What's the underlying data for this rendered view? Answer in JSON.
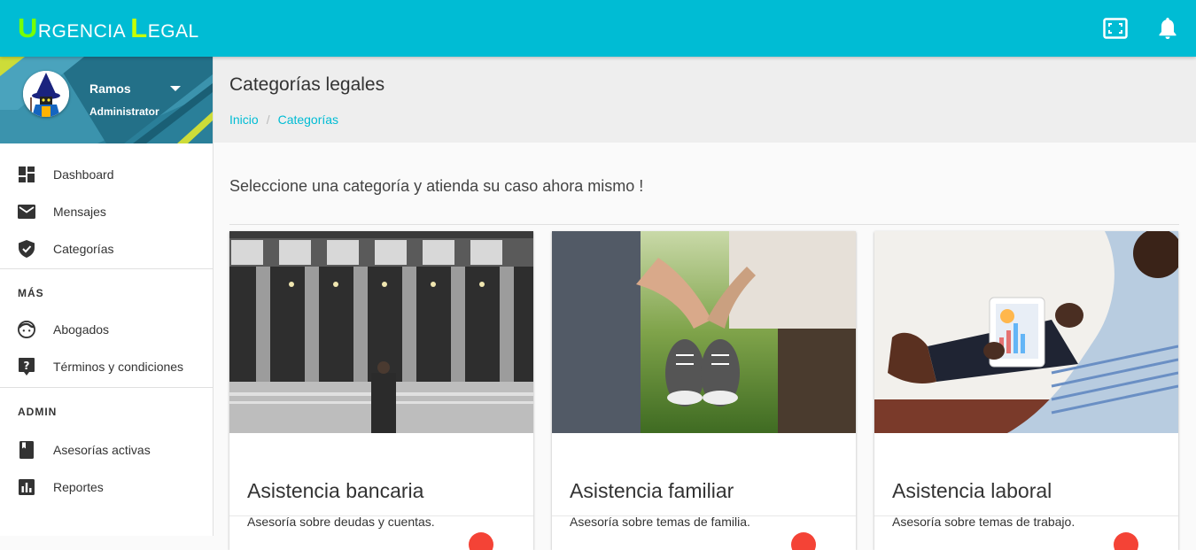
{
  "app": {
    "logo_first_letter": "U",
    "logo_first_rest": "RGENCIA",
    "logo_second_letter": "L",
    "logo_second_rest": "EGAL"
  },
  "topbar": {
    "fullscreen_icon": "fullscreen-icon",
    "notifications_icon": "bell-icon",
    "color": "#00bcd4"
  },
  "user": {
    "name": "Ramos",
    "role": "Administrator"
  },
  "sidebar": {
    "main_items": [
      {
        "label": "Dashboard",
        "icon": "dashboard-icon"
      },
      {
        "label": "Mensajes",
        "icon": "mail-icon"
      },
      {
        "label": "Categorías",
        "icon": "shield-icon"
      }
    ],
    "mas_title": "MÁS",
    "mas_items": [
      {
        "label": "Abogados",
        "icon": "face-icon"
      },
      {
        "label": "Términos y condiciones",
        "icon": "help-icon"
      }
    ],
    "admin_title": "ADMIN",
    "admin_items": [
      {
        "label": "Asesorías activas",
        "icon": "book-icon"
      },
      {
        "label": "Reportes",
        "icon": "bar-chart-icon"
      }
    ]
  },
  "page": {
    "title": "Categorías legales",
    "breadcrumb": [
      "Inicio",
      "Categorías"
    ],
    "intro": "Seleccione una categoría y atienda su caso ahora mismo !"
  },
  "cards": [
    {
      "title": "Asistencia bancaria",
      "description": "Asesoría sobre deudas y cuentas."
    },
    {
      "title": "Asistencia familiar",
      "description": "Asesoría sobre temas de familia."
    },
    {
      "title": "Asistencia laboral",
      "description": "Asesoría sobre temas de trabajo."
    }
  ]
}
